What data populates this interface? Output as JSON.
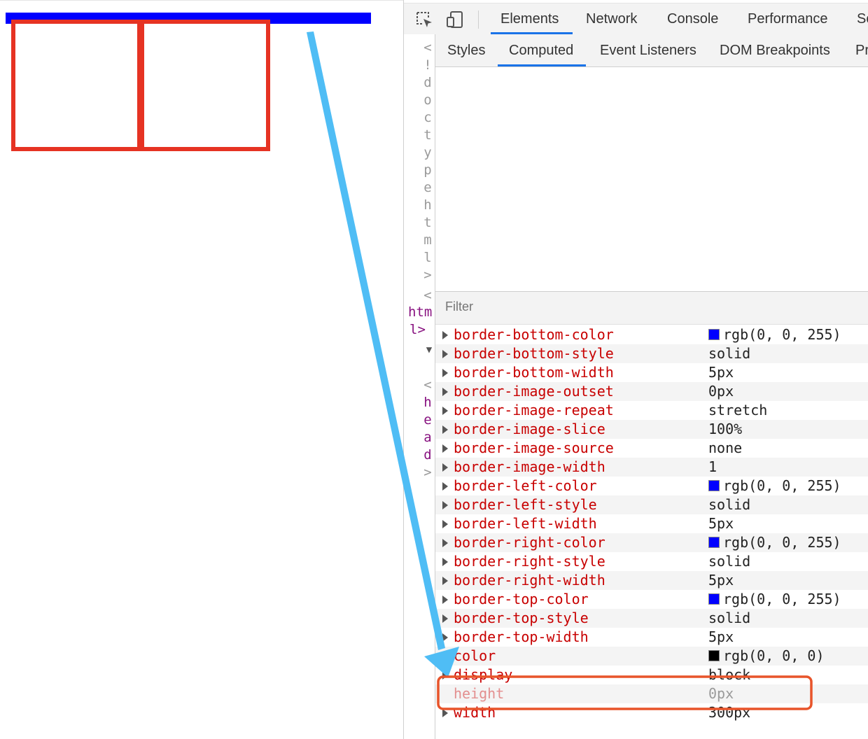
{
  "page": {
    "colors": {
      "bar": "#0000ff",
      "box_border": "#e63323"
    }
  },
  "devtools": {
    "main_tabs": [
      "Elements",
      "Network",
      "Console",
      "Performance",
      "So"
    ],
    "active_main_tab": "Elements",
    "sub_tabs": [
      "Styles",
      "Computed",
      "Event Listeners",
      "DOM Breakpoints",
      "Pr"
    ],
    "active_sub_tab": "Computed",
    "filter_placeholder": "Filter",
    "elements_chars": [
      "<",
      "!",
      "d",
      "o",
      "c",
      "t",
      "y",
      "p",
      "e",
      "h",
      "t",
      "m",
      "l",
      ">",
      "<"
    ],
    "elements_html_lines": [
      "htm",
      "l>"
    ],
    "elements_head_chars": [
      "<",
      "h",
      "e",
      "a",
      "d",
      ">"
    ],
    "computed": [
      {
        "name": "border-bottom-color",
        "value": "rgb(0, 0, 255)",
        "swatch": "#0000ff"
      },
      {
        "name": "border-bottom-style",
        "value": "solid"
      },
      {
        "name": "border-bottom-width",
        "value": "5px"
      },
      {
        "name": "border-image-outset",
        "value": "0px"
      },
      {
        "name": "border-image-repeat",
        "value": "stretch"
      },
      {
        "name": "border-image-slice",
        "value": "100%"
      },
      {
        "name": "border-image-source",
        "value": "none"
      },
      {
        "name": "border-image-width",
        "value": "1"
      },
      {
        "name": "border-left-color",
        "value": "rgb(0, 0, 255)",
        "swatch": "#0000ff"
      },
      {
        "name": "border-left-style",
        "value": "solid"
      },
      {
        "name": "border-left-width",
        "value": "5px"
      },
      {
        "name": "border-right-color",
        "value": "rgb(0, 0, 255)",
        "swatch": "#0000ff"
      },
      {
        "name": "border-right-style",
        "value": "solid"
      },
      {
        "name": "border-right-width",
        "value": "5px"
      },
      {
        "name": "border-top-color",
        "value": "rgb(0, 0, 255)",
        "swatch": "#0000ff"
      },
      {
        "name": "border-top-style",
        "value": "solid"
      },
      {
        "name": "border-top-width",
        "value": "5px"
      },
      {
        "name": "color",
        "value": "rgb(0, 0, 0)",
        "swatch": "#000000"
      },
      {
        "name": "display",
        "value": "block"
      },
      {
        "name": "height",
        "value": "0px",
        "inherited": true,
        "highlighted": true
      },
      {
        "name": "width",
        "value": "300px"
      }
    ]
  },
  "annotation": {
    "arrow_color": "#4fbdf5",
    "highlight_color": "#e8542a"
  }
}
